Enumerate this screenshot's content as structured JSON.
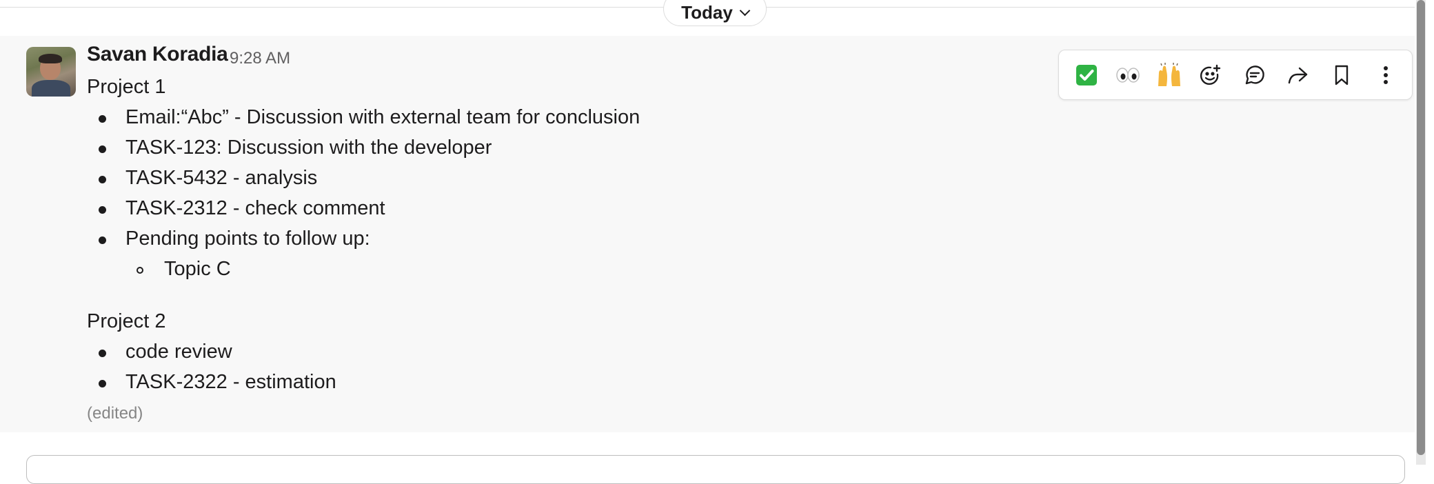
{
  "date_divider": {
    "label": "Today"
  },
  "message": {
    "author": "Savan Koradia",
    "timestamp": "9:28 AM",
    "project1": {
      "title": "Project 1",
      "items": [
        "Email:“Abc” - Discussion with external team for conclusion",
        "TASK-123: Discussion with the developer",
        "TASK-5432 - analysis",
        "TASK-2312 - check comment",
        "Pending points to follow up:"
      ],
      "subitems": [
        "Topic C"
      ]
    },
    "project2": {
      "title": "Project 2",
      "items": [
        "code review",
        "TASK-2322 - estimation"
      ]
    },
    "edited": "(edited)"
  },
  "toolbar": {
    "actions": [
      {
        "icon": "checkmark-emoji-icon",
        "label": "React with white check mark"
      },
      {
        "icon": "eyes-emoji-icon",
        "label": "React with eyes"
      },
      {
        "icon": "raised-hands-emoji-icon",
        "label": "React with raised hands"
      },
      {
        "icon": "add-reaction-icon",
        "label": "Add reaction"
      },
      {
        "icon": "reply-in-thread-icon",
        "label": "Reply in thread"
      },
      {
        "icon": "forward-icon",
        "label": "Forward message"
      },
      {
        "icon": "bookmark-icon",
        "label": "Save for later"
      },
      {
        "icon": "more-actions-icon",
        "label": "More actions"
      }
    ]
  },
  "colors": {
    "check_green": "#2fb344",
    "text": "#1d1c1d",
    "muted": "#616061",
    "message_bg": "#f8f8f8"
  }
}
